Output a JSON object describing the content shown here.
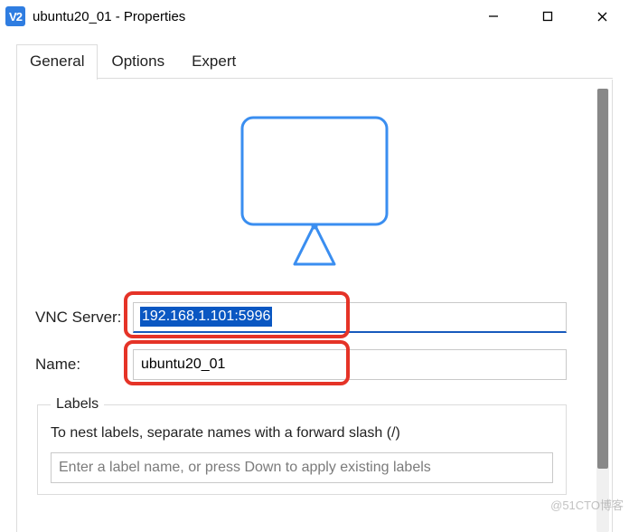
{
  "window": {
    "title": "ubuntu20_01 - Properties",
    "app_icon_text": "V2"
  },
  "tabs": {
    "general": "General",
    "options": "Options",
    "expert": "Expert"
  },
  "form": {
    "vnc_server_label": "VNC Server:",
    "vnc_server_value": "192.168.1.101:5996",
    "name_label": "Name:",
    "name_value": "ubuntu20_01"
  },
  "labels": {
    "legend": "Labels",
    "hint": "To nest labels, separate names with a forward slash (/)",
    "placeholder": "Enter a label name, or press Down to apply existing labels",
    "value": ""
  },
  "watermark": "@51CTO博客"
}
